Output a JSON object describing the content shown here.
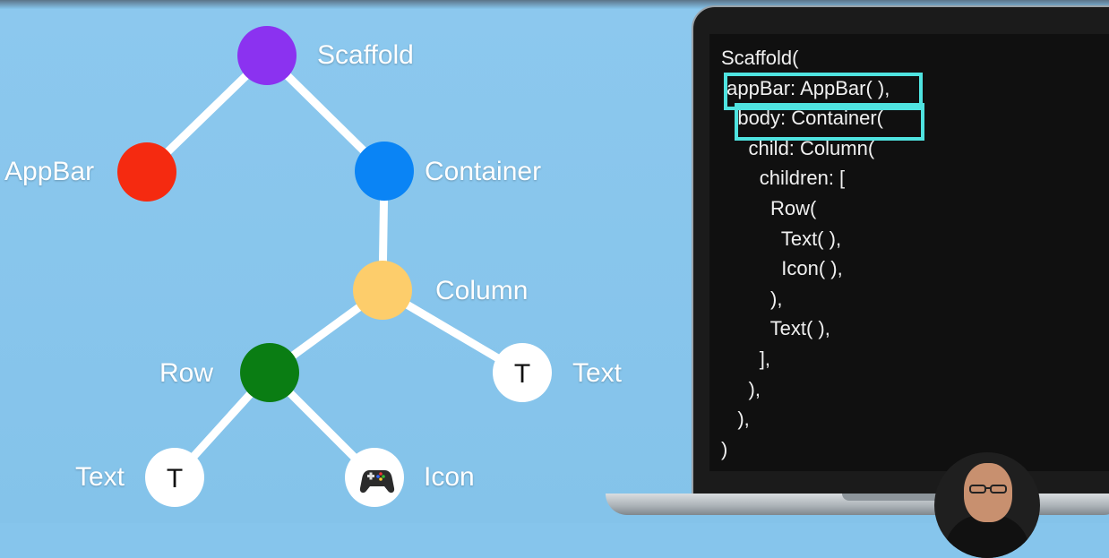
{
  "tree": {
    "nodes": [
      {
        "id": "scaffold",
        "label": "Scaffold",
        "color": "#8b32f0",
        "icon": "none"
      },
      {
        "id": "appbar",
        "label": "AppBar",
        "color": "#f52a10",
        "icon": "none"
      },
      {
        "id": "container",
        "label": "Container",
        "color": "#0a84f5",
        "icon": "none"
      },
      {
        "id": "column",
        "label": "Column",
        "color": "#fdcd6b",
        "icon": "none"
      },
      {
        "id": "row",
        "label": "Row",
        "color": "#0a7d13",
        "icon": "none"
      },
      {
        "id": "text-right",
        "label": "Text",
        "color": "#ffffff",
        "icon": "T"
      },
      {
        "id": "text-left",
        "label": "Text",
        "color": "#ffffff",
        "icon": "T"
      },
      {
        "id": "icon",
        "label": "Icon",
        "color": "#ffffff",
        "icon": "gamepad-icon"
      }
    ],
    "edges": [
      [
        "scaffold",
        "appbar"
      ],
      [
        "scaffold",
        "container"
      ],
      [
        "container",
        "column"
      ],
      [
        "column",
        "row"
      ],
      [
        "column",
        "text-right"
      ],
      [
        "row",
        "text-left"
      ],
      [
        "row",
        "icon"
      ]
    ]
  },
  "code": {
    "lines": [
      "Scaffold(",
      " appBar: AppBar( ),",
      "   body: Container(",
      "     child: Column(",
      "       children: [",
      "         Row(",
      "           Text( ),",
      "           Icon( ),",
      "         ),",
      "         Text( ),",
      "       ],",
      "     ),",
      "   ),",
      ")"
    ],
    "highlight_color": "#4fe3e0",
    "highlighted_lines": [
      "appBar: AppBar( ),",
      "body: Container("
    ]
  }
}
